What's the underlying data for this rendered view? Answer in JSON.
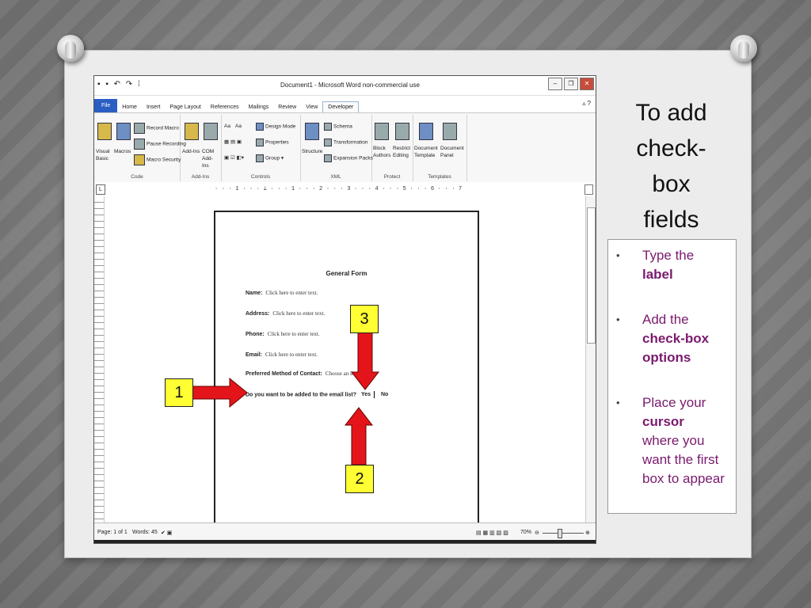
{
  "slide": {
    "title_lines": [
      "To add",
      "check-",
      "box",
      "fields"
    ],
    "bullets": [
      {
        "text_before": "Type the",
        "bold": "label",
        "text_after": ""
      },
      {
        "text_before": "Add the",
        "bold": "check-box options",
        "text_after": ""
      },
      {
        "text_before": "Place your",
        "bold": "cursor",
        "text_after": "where you want the first box to appear"
      }
    ],
    "bullet_symbol": "•",
    "callouts": [
      "1",
      "2",
      "3"
    ],
    "colors": {
      "arrow": "#e3151a",
      "callout_bg": "#ffff33",
      "bullet_text": "#7a1a6e",
      "file_tab": "#2a5ec3"
    }
  },
  "word": {
    "quick_access": "▪ ▪ ↶ ↷ ⁞",
    "title": "Document1 - Microsoft Word non-commercial use",
    "tabs": [
      "File",
      "Home",
      "Insert",
      "Page Layout",
      "References",
      "Mailings",
      "Review",
      "View",
      "Developer"
    ],
    "active_tab": "Developer",
    "ribbon": {
      "code": {
        "label": "Code",
        "visual_basic": "Visual Basic",
        "macros": "Macros",
        "record_macro": "Record Macro",
        "pause_recording": "Pause Recording",
        "macro_security": "Macro Security"
      },
      "addins": {
        "label": "Add-Ins",
        "addins": "Add-Ins",
        "com_addins": "COM Add-Ins"
      },
      "controls": {
        "label": "Controls",
        "aa1": "Aa",
        "aa2": "Aa",
        "design_mode": "Design Mode",
        "properties": "Properties",
        "group": "Group"
      },
      "xml": {
        "label": "XML",
        "structure": "Structure",
        "schema": "Schema",
        "transformation": "Transformation",
        "expansion_packs": "Expansion Packs"
      },
      "protect": {
        "label": "Protect",
        "block_authors": "Block Authors",
        "restrict_editing": "Restrict Editing"
      },
      "templates": {
        "label": "Templates",
        "document_template": "Document Template",
        "document_panel": "Document Panel"
      }
    },
    "ruler": "L",
    "ruler_marks": "· · · 1 · · · ⊥ · · · 1 · · · 2 · · · 3 · · · 4 · · · 5 · · · 6 · · · 7",
    "form": {
      "title": "General Form",
      "fields": [
        {
          "label": "Name:",
          "placeholder": "Click here to enter text."
        },
        {
          "label": "Address:",
          "placeholder": "Click here to enter text."
        },
        {
          "label": "Phone:",
          "placeholder": "Click here to enter text."
        },
        {
          "label": "Email:",
          "placeholder": "Click here to enter text."
        },
        {
          "label": "Preferred Method of Contact:",
          "placeholder": "Choose an item."
        }
      ],
      "question": "Do you want to be added to the email list?",
      "yes": "Yes",
      "no": "No"
    },
    "status": {
      "page": "Page: 1 of 1",
      "words": "Words: 45",
      "zoom": "70%"
    }
  }
}
